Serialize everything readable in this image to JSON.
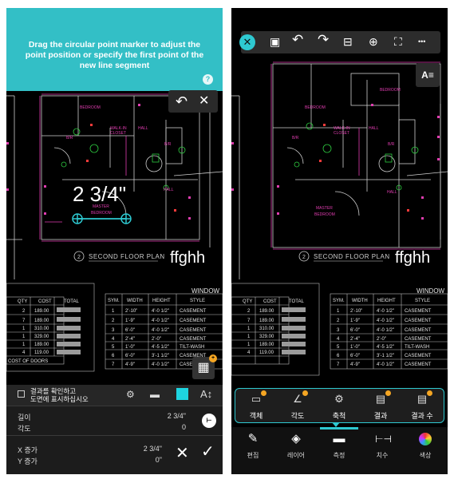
{
  "left": {
    "hint": {
      "text": "Drag the circular point marker to adjust the point position or specify the first point of the new line segment",
      "help_icon": "?"
    },
    "undo_icon": "↶",
    "close_icon": "✕",
    "measurement": "2 3/4\"",
    "label_text": "ffghh",
    "calc_icon": "calculator-icon",
    "calc_badge": "+",
    "panel": {
      "checkbox_label_line1": "결과를 확인하고",
      "checkbox_label_line2": "도면에 표시하십시오",
      "color_swatch": "#1ed4e0",
      "text_icon": "A↕",
      "length_label": "길이",
      "length_value": "2 3/4\"",
      "angle_label": "각도",
      "angle_value": "0",
      "dx_label": "X 증가",
      "dx_value": "2 3/4\"",
      "dy_label": "Y 증가",
      "dy_value": "0\"",
      "cancel_icon": "✕",
      "confirm_icon": "✓"
    },
    "plan": {
      "bedroom": "BEDROOM",
      "walkin1": "WALK-IN",
      "walkin2": "CLOSET",
      "hall": "HALL",
      "bath": "B/R",
      "hall2": "HALL",
      "master1": "MASTER",
      "master2": "BEDROOM",
      "floor_plan": "SECOND FLOOR PLAN",
      "plan_num": "2",
      "window": "WINDOW",
      "cost_of_doors": "COST OF DOORS"
    }
  },
  "right": {
    "toolbar": {
      "close_icon": "✕",
      "save_icon": "💾",
      "undo_icon": "↶",
      "redo_icon": "↷",
      "scan_icon": "⊟",
      "zoom_icon": "⊕",
      "fit_icon": "⛶",
      "more_icon": "•••"
    },
    "text_style_button": "A≡",
    "label_text": "ffghh",
    "sub_items": [
      {
        "label": "객체",
        "icon": "📏"
      },
      {
        "label": "각도",
        "icon": "📐"
      },
      {
        "label": "축척",
        "icon": "⚙"
      },
      {
        "label": "결과",
        "icon": "▤"
      },
      {
        "label": "결과 수",
        "icon": "▤"
      }
    ],
    "bottom_items": [
      {
        "label": "편집",
        "icon": "✎"
      },
      {
        "label": "레이어",
        "icon": "◈"
      },
      {
        "label": "측정",
        "icon": "▬"
      },
      {
        "label": "치수",
        "icon": "⊢⊣"
      },
      {
        "label": "색상",
        "icon": "●"
      }
    ],
    "plan": {
      "bedroom": "BEDROOM",
      "walkin1": "WALK-IN",
      "walkin2": "CLOSET",
      "hall": "HALL",
      "bath": "B/R",
      "hall2": "HALL",
      "master1": "MASTER",
      "master2": "BEDROOM",
      "bedroom_top": "BEDROOM",
      "floor_plan": "SECOND FLOOR PLAN",
      "plan_num": "2",
      "window": "WINDOW"
    }
  },
  "left_table": {
    "headers": [
      "QTY",
      "COST",
      "TOTAL"
    ],
    "rows": [
      [
        "2",
        "189.00"
      ],
      [
        "7",
        "189.00"
      ],
      [
        "1",
        "310.00"
      ],
      [
        "1",
        "329.00"
      ],
      [
        "1",
        "189.00"
      ],
      [
        "4",
        "119.00"
      ]
    ]
  },
  "window_table": {
    "headers": [
      "SYM.",
      "WIDTH",
      "HEIGHT",
      "STYLE"
    ],
    "rows": [
      [
        "1",
        "2'-10\"",
        "4'-0 1/2\"",
        "CASEMENT"
      ],
      [
        "2",
        "1'-9\"",
        "4'-0 1/2\"",
        "CASEMENT"
      ],
      [
        "3",
        "6'-0\"",
        "4'-0 1/2\"",
        "CASEMENT"
      ],
      [
        "4",
        "2'-4\"",
        "2'-0\"",
        "CASEMENT"
      ],
      [
        "5",
        "1'-0\"",
        "4'-5 1/2\"",
        "TILT-WASH"
      ],
      [
        "6",
        "6'-0\"",
        "3'-1 1/2\"",
        "CASEMENT"
      ],
      [
        "7",
        "4'-9\"",
        "4'-0 1/2\"",
        "CASEMENT"
      ]
    ]
  }
}
